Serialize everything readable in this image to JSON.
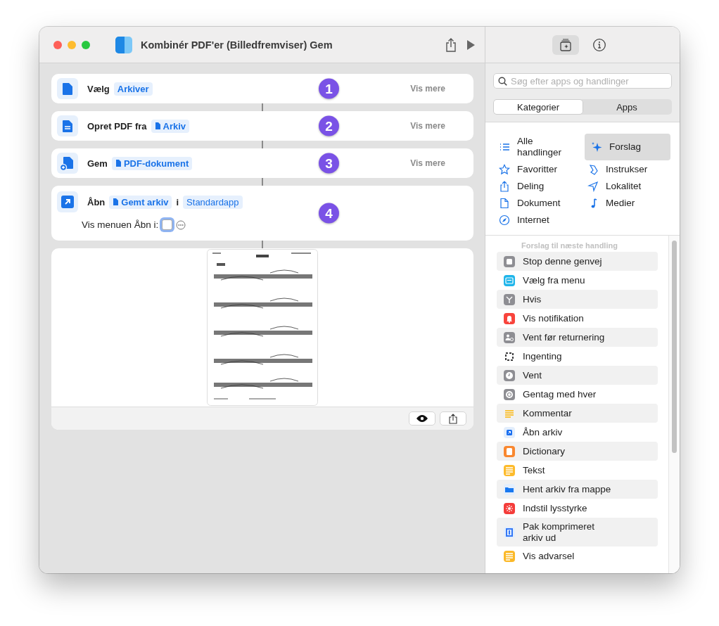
{
  "window": {
    "title": "Kombinér PDF'er (Billedfremviser) Gem"
  },
  "actions": [
    {
      "kind": "doc",
      "badge": "1",
      "more": "Vis mere",
      "parts": [
        {
          "kind": "label",
          "text": "Vælg"
        },
        {
          "kind": "token",
          "text": "Arkiver"
        }
      ]
    },
    {
      "kind": "doc-lines",
      "badge": "2",
      "more": "Vis mere",
      "parts": [
        {
          "kind": "label",
          "text": "Opret PDF fra"
        },
        {
          "kind": "variable",
          "text": "Arkiv"
        }
      ]
    },
    {
      "kind": "doc-plus",
      "badge": "3",
      "more": "Vis mere",
      "parts": [
        {
          "kind": "label",
          "text": "Gem"
        },
        {
          "kind": "variable",
          "text": "PDF-dokument"
        }
      ]
    },
    {
      "kind": "open",
      "badge": "4",
      "parts": [
        {
          "kind": "label",
          "text": "Åbn"
        },
        {
          "kind": "variable",
          "text": "Gemt arkiv"
        },
        {
          "kind": "label",
          "text": "i"
        },
        {
          "kind": "value",
          "text": "Standardapp"
        }
      ],
      "option": {
        "label": "Vis menuen Åbn i:",
        "checked": false
      }
    }
  ],
  "toolbar": [
    {
      "kind": "library",
      "selected": true
    },
    {
      "kind": "info",
      "selected": false
    }
  ],
  "search": {
    "placeholder": "Søg efter apps og handlinger"
  },
  "segments": [
    {
      "label": "Kategorier",
      "selected": true
    },
    {
      "label": "Apps",
      "selected": false
    }
  ],
  "categories": [
    {
      "label": "Alle handlinger",
      "kind": "list",
      "selected": false
    },
    {
      "label": "Forslag",
      "kind": "sparkle",
      "selected": true
    },
    {
      "label": "Favoritter",
      "kind": "star",
      "selected": false
    },
    {
      "label": "Instrukser",
      "kind": "scroll",
      "selected": false
    },
    {
      "label": "Deling",
      "kind": "share",
      "selected": false
    },
    {
      "label": "Lokalitet",
      "kind": "location",
      "selected": false
    },
    {
      "label": "Dokument",
      "kind": "doc",
      "selected": false
    },
    {
      "label": "Medier",
      "kind": "note",
      "selected": false
    },
    {
      "label": "Internet",
      "kind": "compass",
      "selected": false
    }
  ],
  "suggestions": {
    "heading": "Forslag til næste handling",
    "items": [
      {
        "label": "Stop denne genvej",
        "kind": "stop",
        "color": "#8e8e93"
      },
      {
        "label": "Vælg fra menu",
        "kind": "menu",
        "color": "#1fb5ea"
      },
      {
        "label": "Hvis",
        "kind": "branch",
        "color": "#8e8e93"
      },
      {
        "label": "Vis notifikation",
        "kind": "bell",
        "color": "#f8443c"
      },
      {
        "label": "Vent før returnering",
        "kind": "person",
        "color": "#8e8e93"
      },
      {
        "label": "Ingenting",
        "kind": "dashed",
        "color": "#3a3a3c"
      },
      {
        "label": "Vent",
        "kind": "clock",
        "color": "#8e8e93"
      },
      {
        "label": "Gentag med hver",
        "kind": "repeat",
        "color": "#8e8e93"
      },
      {
        "label": "Kommentar",
        "kind": "comment",
        "color": "#f9c33d"
      },
      {
        "label": "Åbn arkiv",
        "kind": "open",
        "color": "#1a6ff0"
      },
      {
        "label": "Dictionary",
        "kind": "book",
        "color": "#f9872f"
      },
      {
        "label": "Tekst",
        "kind": "text",
        "color": "#fdbb2b"
      },
      {
        "label": "Hent arkiv fra mappe",
        "kind": "folder",
        "color": "#1878f0"
      },
      {
        "label": "Indstil lysstyrke",
        "kind": "sun",
        "color": "#f43c3a"
      },
      {
        "label": "Pak komprimeret\narkiv ud",
        "kind": "zip",
        "color": "#3478f6"
      },
      {
        "label": "Vis advarsel",
        "kind": "alert",
        "color": "#fbb929"
      }
    ]
  }
}
